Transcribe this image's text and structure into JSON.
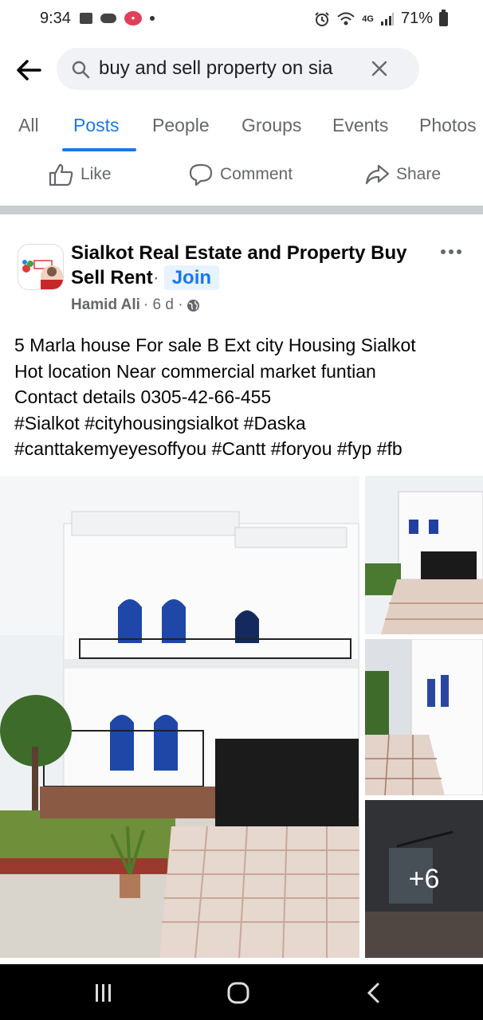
{
  "status_bar": {
    "time": "9:34",
    "network": "4G",
    "battery": "71%",
    "icons": [
      "image-icon",
      "cloud-icon",
      "app-badge-icon",
      "dot-icon",
      "alarm-icon",
      "wifi-icon",
      "signal-icon",
      "battery-icon"
    ]
  },
  "search": {
    "query": "buy and sell property on sia",
    "icons": [
      "back-arrow-icon",
      "search-icon",
      "clear-icon"
    ]
  },
  "tabs": [
    {
      "label": "All",
      "active": false
    },
    {
      "label": "Posts",
      "active": true
    },
    {
      "label": "People",
      "active": false
    },
    {
      "label": "Groups",
      "active": false
    },
    {
      "label": "Events",
      "active": false
    },
    {
      "label": "Photos",
      "active": false
    }
  ],
  "actions": {
    "like": "Like",
    "comment": "Comment",
    "share": "Share"
  },
  "post": {
    "group_name": "Sialkot Real Estate and Property Buy Sell Rent",
    "dot": "·",
    "join_label": "Join",
    "author": "Hamid Ali",
    "time": "· 6 d ·",
    "text_lines": [
      "5 Marla house For sale B Ext city Housing Sialkot",
      "Hot location Near commercial market funtian",
      "Contact details 0305-42-66-455",
      "#Sialkot #cityhousingsialkot #Daska",
      "#canttakemyeyesoffyou #Cantt #foryou #fyp #fb"
    ],
    "more_photos": "+6"
  },
  "colors": {
    "accent": "#1877f2",
    "join_bg": "#e7f3ff",
    "muted": "#65676b",
    "separator": "#c9ccd1"
  }
}
